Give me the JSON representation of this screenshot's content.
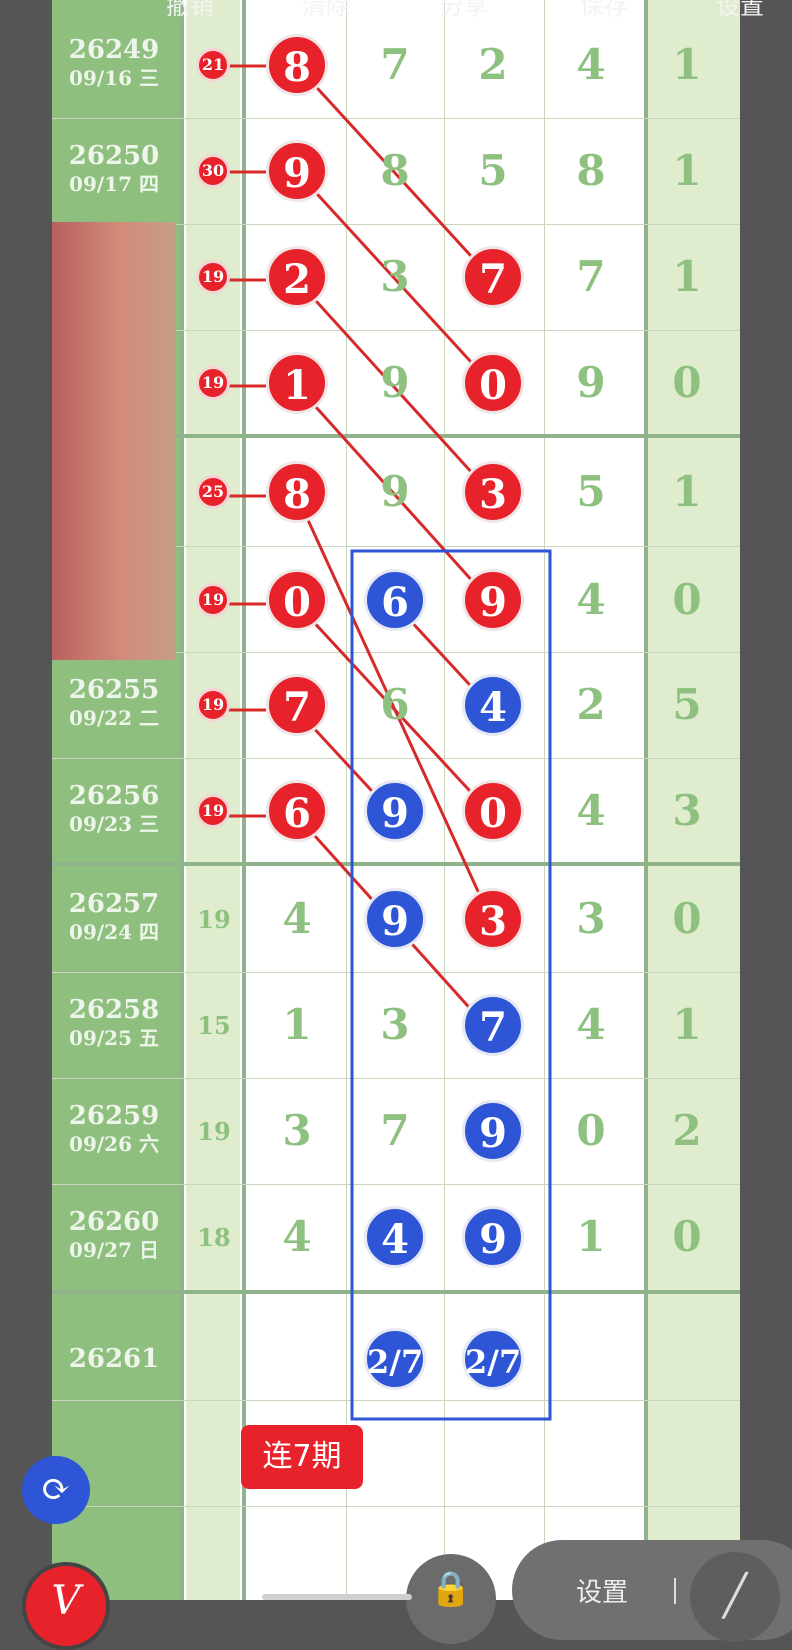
{
  "header": {
    "labels": [
      "撤销",
      "清除",
      "分享",
      "保存",
      "设置"
    ]
  },
  "rows": [
    {
      "period": "26249",
      "date": "09/16 三",
      "sum": "21",
      "a": "8",
      "b": "7",
      "c": "2",
      "d": "4",
      "e": "1"
    },
    {
      "period": "26250",
      "date": "09/17 四",
      "sum": "30",
      "a": "9",
      "b": "8",
      "c": "5",
      "d": "8",
      "e": "1"
    },
    {
      "period": "",
      "date": "",
      "sum": "19",
      "a": "2",
      "b": "3",
      "c": "7",
      "d": "7",
      "e": "1"
    },
    {
      "period": "",
      "date": "",
      "sum": "19",
      "a": "1",
      "b": "9",
      "c": "0",
      "d": "9",
      "e": "0"
    },
    {
      "period": "",
      "date": "",
      "sum": "25",
      "a": "8",
      "b": "9",
      "c": "3",
      "d": "5",
      "e": "1"
    },
    {
      "period": "",
      "date": "",
      "sum": "19",
      "a": "0",
      "b": "6",
      "c": "9",
      "d": "4",
      "e": "0"
    },
    {
      "period": "26255",
      "date": "09/22 二",
      "sum": "19",
      "a": "7",
      "b": "6",
      "c": "4",
      "d": "2",
      "e": "5"
    },
    {
      "period": "26256",
      "date": "09/23 三",
      "sum": "19",
      "a": "6",
      "b": "9",
      "c": "0",
      "d": "4",
      "e": "3"
    },
    {
      "period": "26257",
      "date": "09/24 四",
      "sum": "19",
      "a": "4",
      "b": "9",
      "c": "3",
      "d": "3",
      "e": "0"
    },
    {
      "period": "26258",
      "date": "09/25 五",
      "sum": "15",
      "a": "1",
      "b": "3",
      "c": "7",
      "d": "4",
      "e": "1"
    },
    {
      "period": "26259",
      "date": "09/26 六",
      "sum": "19",
      "a": "3",
      "b": "7",
      "c": "9",
      "d": "0",
      "e": "2"
    },
    {
      "period": "26260",
      "date": "09/27 日",
      "sum": "18",
      "a": "4",
      "b": "4",
      "c": "9",
      "d": "1",
      "e": "0"
    }
  ],
  "forecast": {
    "period": "26261",
    "b": "2/7",
    "c": "2/7"
  },
  "streak_badge": "连7期",
  "toolbar": {
    "settings_label": "设置"
  },
  "colors": {
    "red": "#e8222a",
    "blue": "#2d55d6",
    "green": "#8ec180",
    "period_bg": "#8fbf7f"
  }
}
